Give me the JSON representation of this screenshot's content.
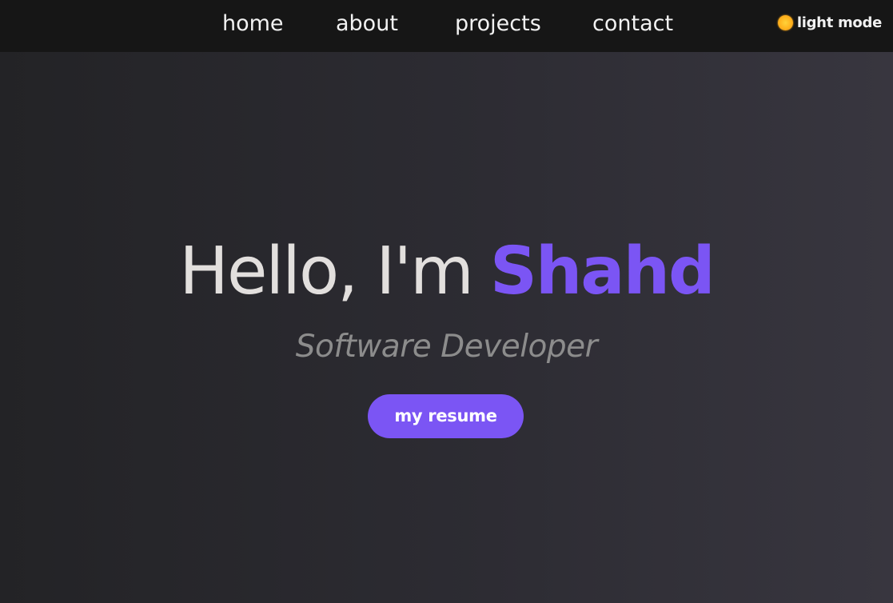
{
  "nav": {
    "items": [
      {
        "label": "home"
      },
      {
        "label": "about"
      },
      {
        "label": "projects"
      },
      {
        "label": "contact"
      }
    ],
    "theme_toggle": {
      "icon": "sun-icon",
      "label": "light mode"
    }
  },
  "hero": {
    "greeting": "Hello, I'm",
    "name": "Shahd",
    "subtitle": "Software Developer",
    "button_label": "my resume"
  },
  "colors": {
    "accent": "#7b55f4",
    "nav_background": "#161616",
    "background_start": "#232326",
    "background_end": "#38363f",
    "subtitle": "#8c8c8c",
    "greeting": "#e2dfdd"
  }
}
